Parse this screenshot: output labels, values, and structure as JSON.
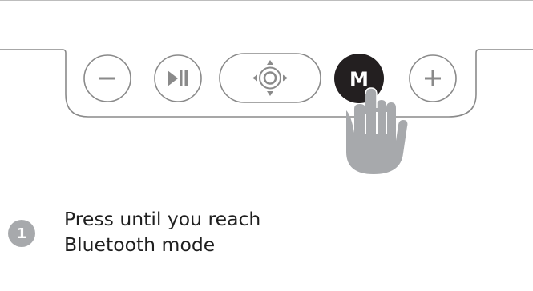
{
  "illustration": {
    "buttons": {
      "minus_icon": "minus-icon",
      "play_pause_icon": "play-pause-icon",
      "navigation_icon": "navigation-joystick-icon",
      "mode_label": "M",
      "plus_icon": "plus-icon"
    },
    "highlighted_button": "mode",
    "hand_icon": "pointing-hand-icon",
    "colors": {
      "outline": "#8a8a8a",
      "mode_button": "#231f20",
      "hand": "#a7a9ac",
      "step_badge": "#a7a9ac"
    }
  },
  "step": {
    "number": "1",
    "instruction_lines": [
      "Press until you reach",
      "Bluetooth mode"
    ]
  }
}
